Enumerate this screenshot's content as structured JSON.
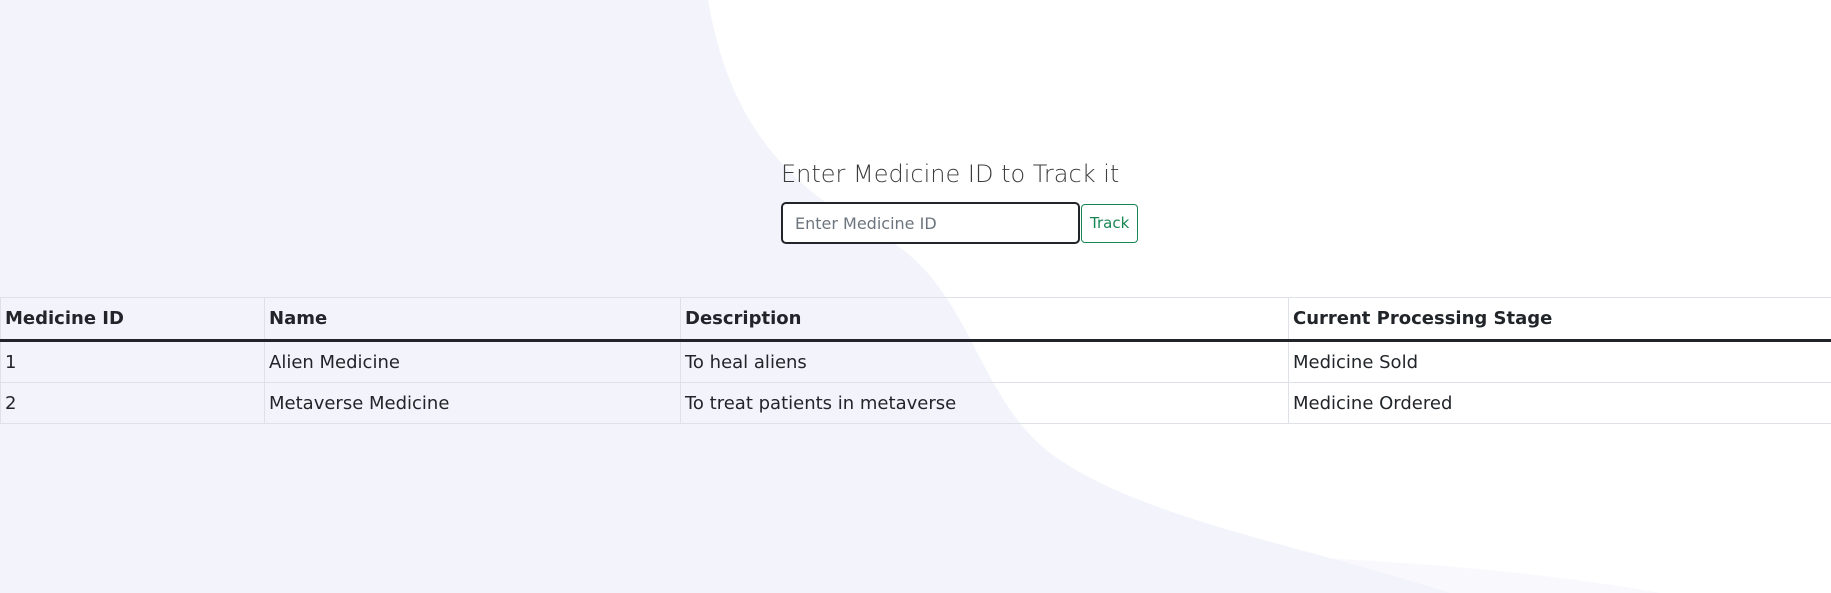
{
  "tracker": {
    "heading": "Enter Medicine ID to Track it",
    "input_placeholder": "Enter Medicine ID",
    "input_value": "",
    "track_button_label": "Track"
  },
  "table": {
    "columns": [
      "Medicine ID",
      "Name",
      "Description",
      "Current Processing Stage"
    ],
    "rows": [
      [
        "1",
        "Alien Medicine",
        "To heal aliens",
        "Medicine Sold"
      ],
      [
        "2",
        "Metaverse Medicine",
        "To treat patients in metaverse",
        "Medicine Ordered"
      ]
    ]
  },
  "colors": {
    "background": "#ffffff",
    "wave_fill": "#f3f4fb",
    "wave_fill_light": "#f8f8fd",
    "button_accent": "#198754",
    "text": "#212529"
  }
}
